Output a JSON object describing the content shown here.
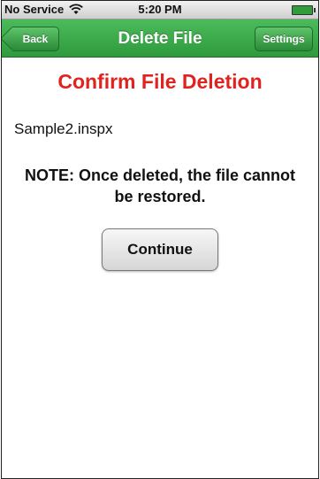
{
  "status_bar": {
    "carrier": "No Service",
    "time": "5:20 PM"
  },
  "nav_bar": {
    "back_label": "Back",
    "title": "Delete File",
    "settings_label": "Settings"
  },
  "main": {
    "heading": "Confirm File Deletion",
    "filename": "Sample2.inspx",
    "note": "NOTE: Once deleted, the file cannot be restored.",
    "continue_label": "Continue"
  },
  "colors": {
    "accent_green": "#3aaa48",
    "heading_red": "#e0231f"
  }
}
